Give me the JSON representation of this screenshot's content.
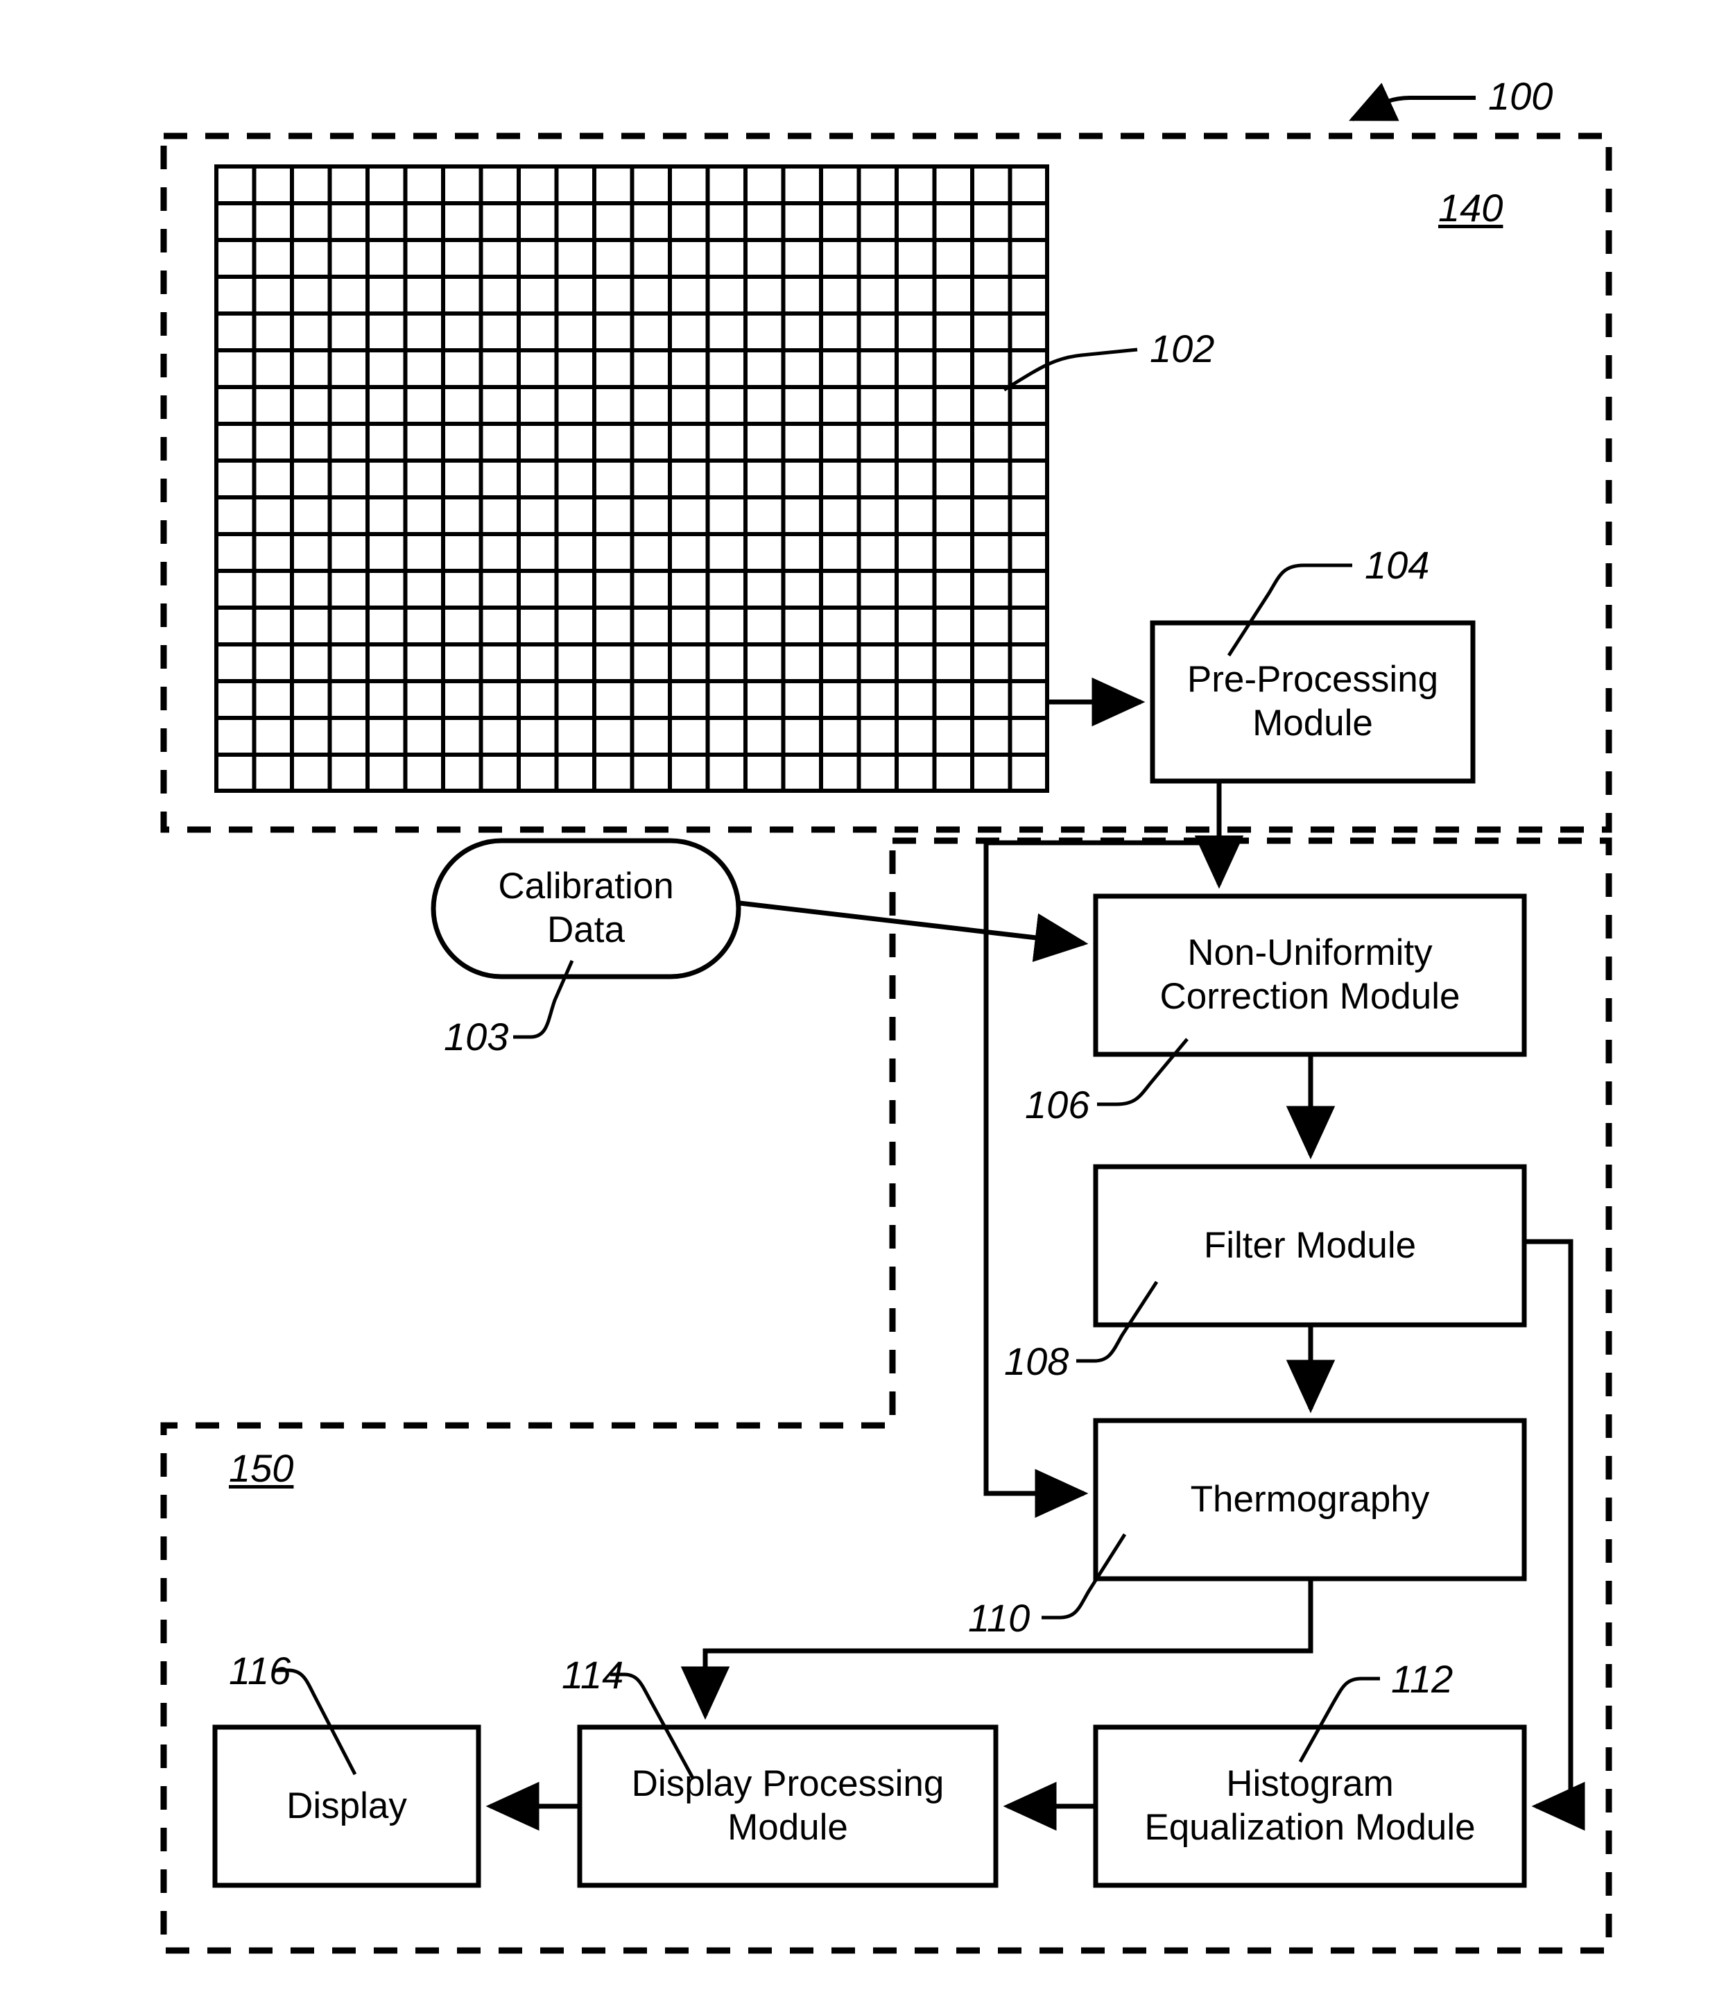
{
  "figure": {
    "type": "patent-block-diagram",
    "system_ref": "100",
    "groups": [
      {
        "ref": "140",
        "name": "imaging-group"
      },
      {
        "ref": "150",
        "name": "display-group"
      }
    ]
  },
  "refs": {
    "r100": "100",
    "r102": "102",
    "r103": "103",
    "r104": "104",
    "r106": "106",
    "r108": "108",
    "r110": "110",
    "r112": "112",
    "r114": "114",
    "r116": "116",
    "r140": "140",
    "r150": "150"
  },
  "nodes": {
    "focal_plane_array": {
      "ref": "102",
      "label": "",
      "shape": "grid",
      "columns": 22,
      "rows": 17
    },
    "calibration_data": {
      "ref": "103",
      "label": "Calibration\nData",
      "line1": "Calibration",
      "line2": "Data",
      "shape": "stadium"
    },
    "pre_processing": {
      "ref": "104",
      "label": "Pre-Processing Module",
      "line1": "Pre-Processing",
      "line2": "Module",
      "shape": "rect"
    },
    "nuc": {
      "ref": "106",
      "label": "Non-Uniformity Correction Module",
      "line1": "Non-Uniformity",
      "line2": "Correction Module",
      "shape": "rect"
    },
    "filter": {
      "ref": "108",
      "label": "Filter Module",
      "line1": "Filter Module",
      "line2": "",
      "shape": "rect"
    },
    "thermography": {
      "ref": "110",
      "label": "Thermography",
      "line1": "Thermography",
      "line2": "",
      "shape": "rect"
    },
    "histogram_equalization": {
      "ref": "112",
      "label": "Histogram Equalization Module",
      "line1": "Histogram",
      "line2": "Equalization Module",
      "shape": "rect"
    },
    "display_processing": {
      "ref": "114",
      "label": "Display Processing Module",
      "line1": "Display Processing",
      "line2": "Module",
      "shape": "rect"
    },
    "display": {
      "ref": "116",
      "label": "Display",
      "line1": "Display",
      "line2": "",
      "shape": "rect"
    }
  },
  "edges": [
    {
      "from": "focal_plane_array",
      "to": "pre_processing",
      "arrow": true
    },
    {
      "from": "pre_processing",
      "to": "nuc",
      "arrow": true
    },
    {
      "from": "pre_processing",
      "to": "thermography",
      "arrow": true
    },
    {
      "from": "calibration_data",
      "to": "nuc",
      "arrow": true
    },
    {
      "from": "nuc",
      "to": "filter",
      "arrow": true
    },
    {
      "from": "filter",
      "to": "thermography",
      "arrow": true
    },
    {
      "from": "filter",
      "to": "histogram_equalization",
      "arrow": true
    },
    {
      "from": "thermography",
      "to": "display_processing",
      "arrow": true
    },
    {
      "from": "histogram_equalization",
      "to": "display_processing",
      "arrow": true
    },
    {
      "from": "display_processing",
      "to": "display",
      "arrow": true
    }
  ],
  "colors": {
    "stroke": "#000000",
    "background": "#ffffff"
  }
}
